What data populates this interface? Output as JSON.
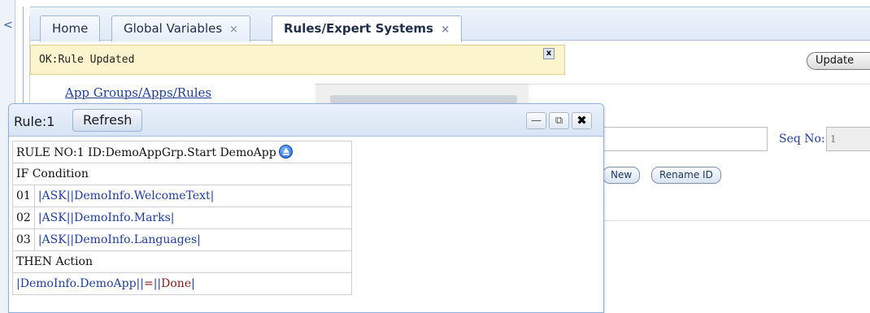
{
  "tabs": [
    {
      "label": "Home",
      "closable": false
    },
    {
      "label": "Global Variables",
      "closable": true
    },
    {
      "label": "Rules/Expert Systems",
      "closable": true,
      "active": true
    }
  ],
  "tab_close_glyph": "×",
  "left_toggle_glyph": "<",
  "status": {
    "text": "OK:Rule Updated",
    "close_glyph": "x"
  },
  "update_label": "Update",
  "app_groups_link": "App Groups/Apps/Rules",
  "seq": {
    "label": "Seq No:",
    "value": "1"
  },
  "buttons": {
    "new": "New",
    "rename": "Rename ID"
  },
  "dialog": {
    "title": "Rule:1",
    "refresh": "Refresh",
    "minimize_glyph": "—",
    "popout_glyph": "⧉",
    "close_glyph": "✖",
    "rule_header": "RULE NO:1 ID:DemoAppGrp.Start DemoApp",
    "if_label": "IF Condition",
    "conditions": [
      {
        "num": "01",
        "keyword": "ASK",
        "target": "DemoInfo.WelcomeText"
      },
      {
        "num": "02",
        "keyword": "ASK",
        "target": "DemoInfo.Marks"
      },
      {
        "num": "03",
        "keyword": "ASK",
        "target": "DemoInfo.Languages"
      }
    ],
    "then_label": "THEN Action",
    "action": {
      "target": "DemoInfo.DemoApp",
      "op": "=",
      "value": "Done"
    }
  },
  "colors": {
    "accent": "#1f3e9e",
    "status_bg": "#fbf4cc",
    "value": "#8a1b1b"
  }
}
